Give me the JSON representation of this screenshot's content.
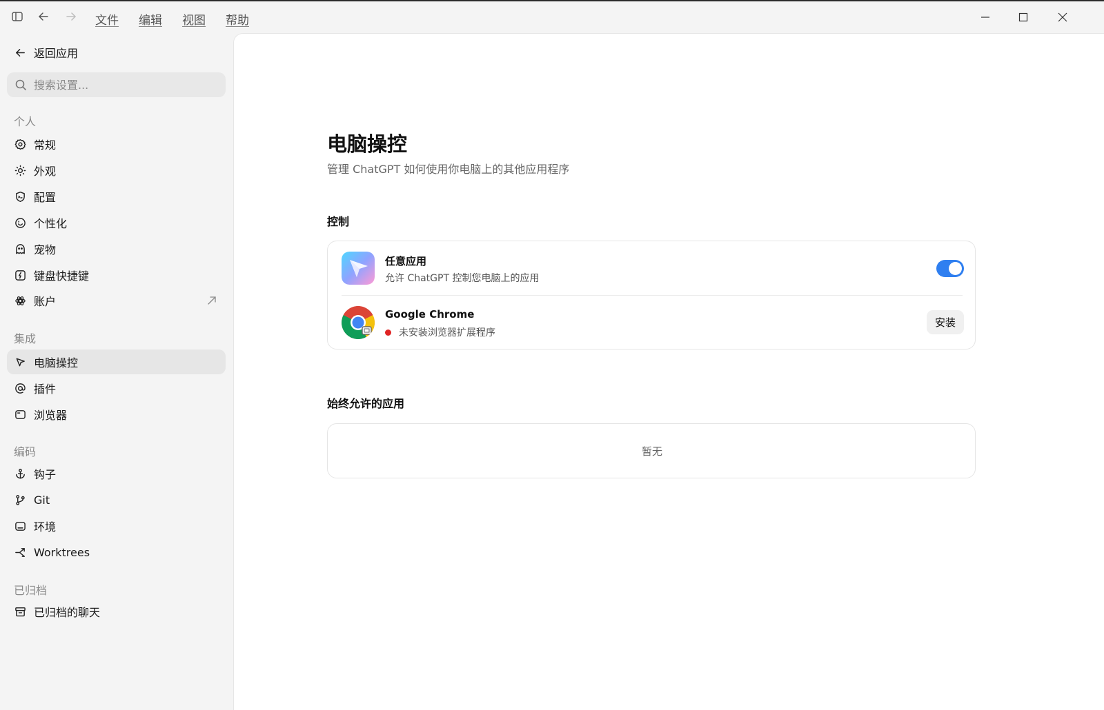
{
  "titlebar": {
    "menus": [
      "文件",
      "编辑",
      "视图",
      "帮助"
    ]
  },
  "sidebar": {
    "back_label": "返回应用",
    "search_placeholder": "搜索设置...",
    "sections": [
      {
        "label": "个人",
        "items": [
          {
            "label": "常规",
            "icon": "gear-icon"
          },
          {
            "label": "外观",
            "icon": "sun-icon"
          },
          {
            "label": "配置",
            "icon": "shield-icon"
          },
          {
            "label": "个性化",
            "icon": "smile-icon"
          },
          {
            "label": "宠物",
            "icon": "pet-icon"
          },
          {
            "label": "键盘快捷键",
            "icon": "keyboard-icon"
          },
          {
            "label": "账户",
            "icon": "account-icon"
          }
        ]
      },
      {
        "label": "集成",
        "items": [
          {
            "label": "电脑操控",
            "icon": "cursor-icon",
            "active": true
          },
          {
            "label": "插件",
            "icon": "at-icon"
          },
          {
            "label": "浏览器",
            "icon": "browser-icon"
          }
        ]
      },
      {
        "label": "编码",
        "items": [
          {
            "label": "钩子",
            "icon": "anchor-icon"
          },
          {
            "label": "Git",
            "icon": "git-branch-icon"
          },
          {
            "label": "环境",
            "icon": "environment-icon"
          },
          {
            "label": "Worktrees",
            "icon": "worktree-icon"
          }
        ]
      },
      {
        "label": "已归档",
        "items": [
          {
            "label": "已归档的聊天",
            "icon": "archive-icon"
          }
        ]
      }
    ]
  },
  "main": {
    "title": "电脑操控",
    "subtitle": "管理 ChatGPT 如何使用你电脑上的其他应用程序",
    "control_section": {
      "heading": "控制",
      "rows": [
        {
          "title": "任意应用",
          "subtitle": "允许 ChatGPT 控制您电脑上的应用",
          "toggle_on": true,
          "icon": "any-app-icon"
        },
        {
          "title": "Google Chrome",
          "subtitle": "未安装浏览器扩展程序",
          "status_color": "#e02424",
          "button": "安装",
          "icon": "chrome-icon"
        }
      ]
    },
    "allowed_section": {
      "heading": "始终允许的应用",
      "empty_text": "暂无"
    }
  },
  "colors": {
    "accent": "#2f7ff0",
    "sidebar_bg": "#f4f4f4",
    "active_item_bg": "#e6e6e6",
    "error_dot": "#e02424"
  }
}
